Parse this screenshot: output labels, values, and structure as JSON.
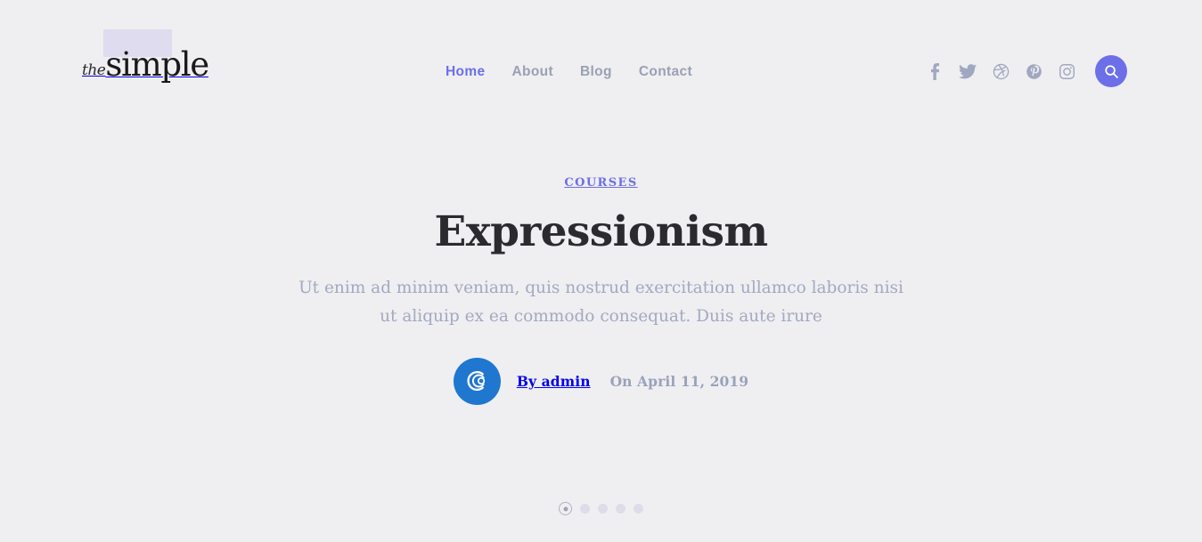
{
  "theme": {
    "background": "#efeff1",
    "accent": "#6c6fe8",
    "muted_text": "#9aa2bb",
    "heading_text": "#2b2b2f",
    "avatar_blue": "#1f77d0",
    "logo_highlight": "#dedcee",
    "dot_inactive": "#dedce9"
  },
  "header": {
    "logo": {
      "prefix": "the",
      "name": "simple"
    },
    "nav": {
      "items": [
        {
          "label": "Home",
          "active": true
        },
        {
          "label": "About",
          "active": false
        },
        {
          "label": "Blog",
          "active": false
        },
        {
          "label": "Contact",
          "active": false
        }
      ]
    },
    "social": [
      {
        "name": "facebook-icon",
        "label": "Facebook"
      },
      {
        "name": "twitter-icon",
        "label": "Twitter"
      },
      {
        "name": "dribbble-icon",
        "label": "Dribbble"
      },
      {
        "name": "pinterest-icon",
        "label": "Pinterest"
      },
      {
        "name": "instagram-icon",
        "label": "Instagram"
      }
    ],
    "search": {
      "icon": "search-icon",
      "label": "Search"
    }
  },
  "hero": {
    "category": "COURSES",
    "title": "Expressionism",
    "excerpt_line1": "Ut enim ad minim veniam, quis nostrud exercitation ullamco laboris nisi ut aliquip",
    "excerpt_line2": "ex ea commodo consequat. Duis aute irure",
    "excerpt": "Ut enim ad minim veniam, quis nostrud exercitation ullamco laboris nisi ut aliquip ex ea commodo consequat. Duis aute irure",
    "meta": {
      "author": "By admin",
      "date": "On April 11, 2019",
      "avatar_icon": "avatar-logo-c"
    }
  },
  "slider": {
    "dots": [
      {
        "index": 1,
        "active": true
      },
      {
        "index": 2,
        "active": false
      },
      {
        "index": 3,
        "active": false
      },
      {
        "index": 4,
        "active": false
      },
      {
        "index": 5,
        "active": false
      }
    ]
  }
}
